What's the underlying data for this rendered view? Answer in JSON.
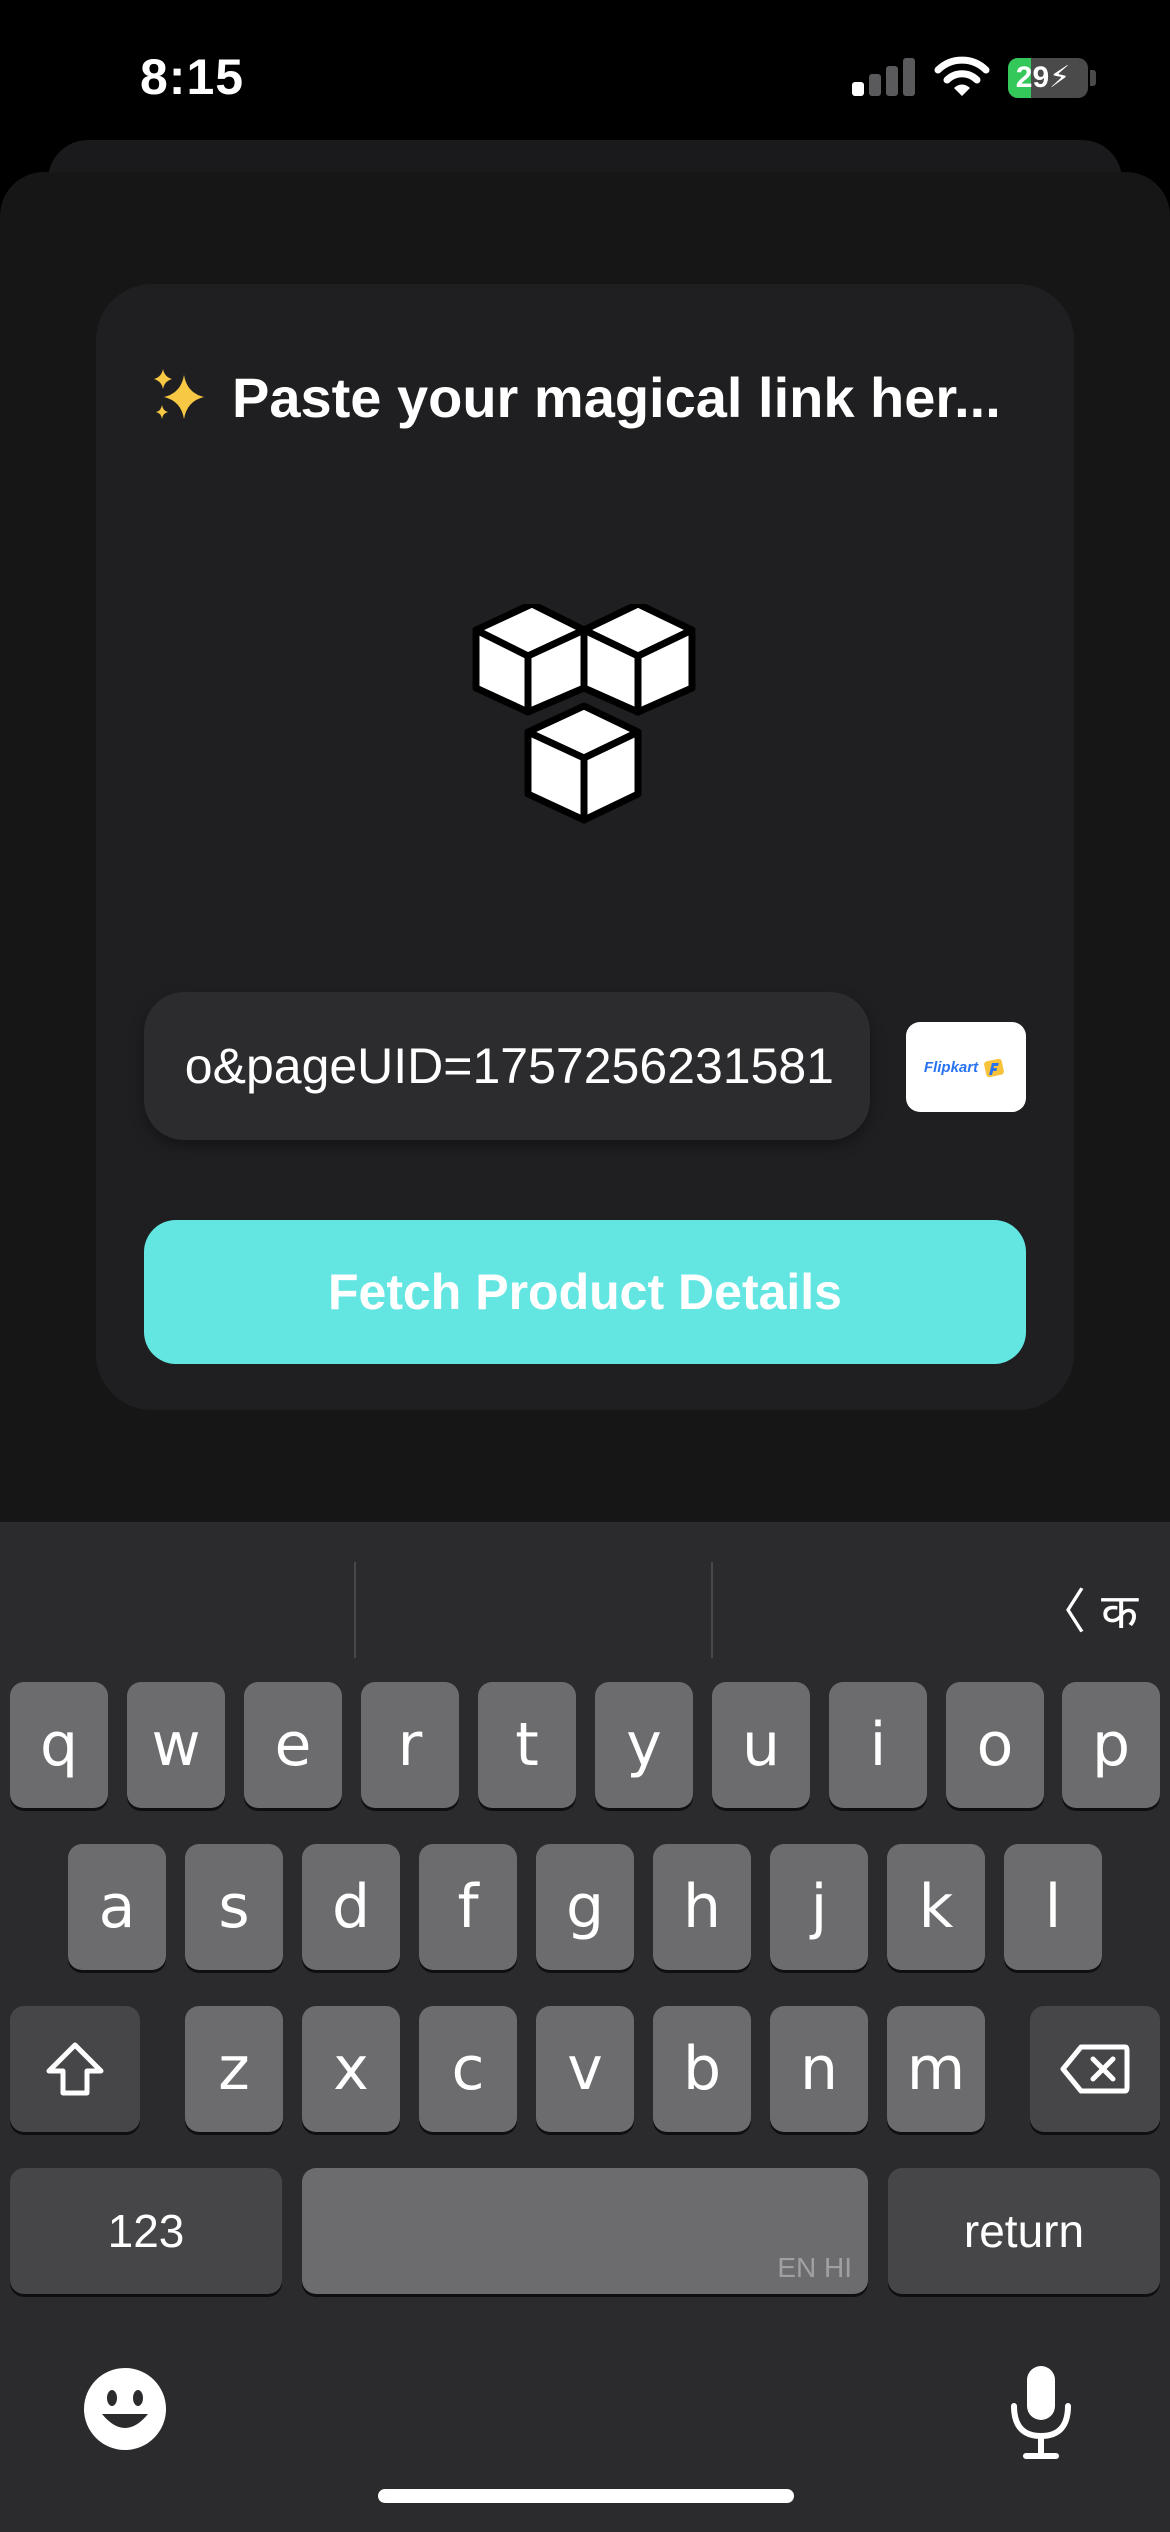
{
  "status_bar": {
    "time": "8:15",
    "battery_level": "29",
    "battery_percent": 29,
    "battery_charging": true,
    "signal_bars_active": 1,
    "signal_bars_total": 4,
    "icons": [
      "cellular-signal-icon",
      "wifi-icon",
      "battery-charging-icon"
    ]
  },
  "card": {
    "title_emoji": "sparkles-icon",
    "title": "Paste your magical link her...",
    "illustration": "cubes-icon",
    "url_value": "o&pageUID=1757256231581",
    "store_badge": "Flipkart",
    "store_badge_icon": "flipkart-logo-icon",
    "fetch_label": "Fetch Product Details"
  },
  "keyboard": {
    "suggestions": [
      "",
      "",
      ""
    ],
    "language_switch": "〈 क",
    "row1": [
      "q",
      "w",
      "e",
      "r",
      "t",
      "y",
      "u",
      "i",
      "o",
      "p"
    ],
    "row2": [
      "a",
      "s",
      "d",
      "f",
      "g",
      "h",
      "j",
      "k",
      "l"
    ],
    "row3": [
      "z",
      "x",
      "c",
      "v",
      "b",
      "n",
      "m"
    ],
    "shift_icon": "shift-icon",
    "delete_icon": "backspace-icon",
    "numbers_label": "123",
    "space_hint": "EN HI",
    "return_label": "return",
    "emoji_icon": "emoji-icon",
    "mic_icon": "microphone-icon"
  },
  "colors": {
    "accent": "#63e6e2",
    "background": "#161617",
    "card": "#1f1f21",
    "battery_green": "#34c759",
    "flipkart_blue": "#2874f0",
    "flipkart_yellow": "#f8c23b"
  }
}
